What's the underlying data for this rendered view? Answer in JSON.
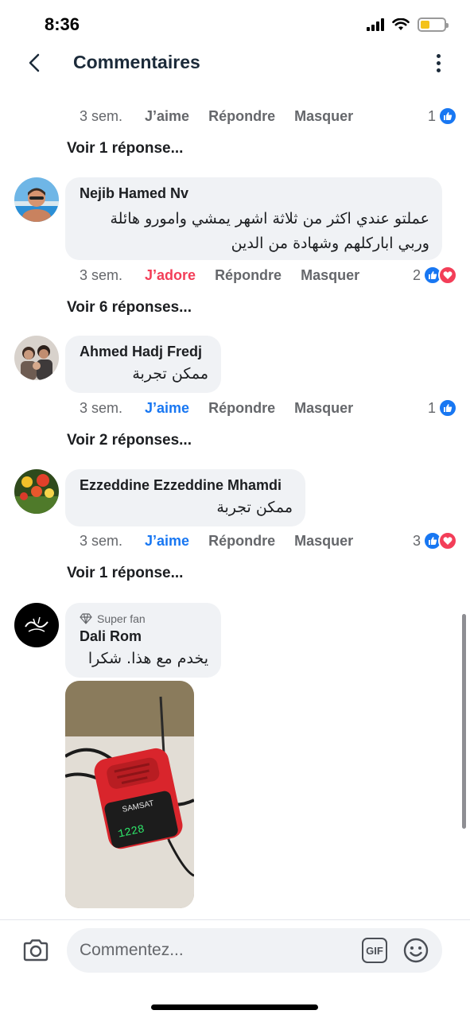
{
  "status_bar": {
    "time": "8:36"
  },
  "header": {
    "title": "Commentaires"
  },
  "colors": {
    "like_blue": "#1877f2",
    "love_red": "#f33e58",
    "bubble_bg": "#f0f2f5",
    "secondary_text": "#65676b"
  },
  "top_actions": {
    "time": "3 sem.",
    "react_label": "J’aime",
    "reply_label": "Répondre",
    "hide_label": "Masquer",
    "reaction_count": "1",
    "see_replies": "Voir 1 réponse..."
  },
  "comments": [
    {
      "author": "Nejib Hamed Nv",
      "text_line1": "عملتو عندي اكثر من ثلاثة اشهر يمشي وامورو هائلة",
      "text_line2": "وربي اباركلهم وشهادة من الدين",
      "time": "3 sem.",
      "react_label": "J’adore",
      "reply_label": "Répondre",
      "hide_label": "Masquer",
      "reaction_count": "2",
      "see_replies": "Voir 6 réponses..."
    },
    {
      "author": "Ahmed Hadj Fredj",
      "text": "ممكن تجربة",
      "time": "3 sem.",
      "react_label": "J’aime",
      "reply_label": "Répondre",
      "hide_label": "Masquer",
      "reaction_count": "1",
      "see_replies": "Voir 2 réponses..."
    },
    {
      "author": "Ezzeddine Ezzeddine Mhamdi",
      "text": "ممكن تجربة",
      "time": "3 sem.",
      "react_label": "J’aime",
      "reply_label": "Répondre",
      "hide_label": "Masquer",
      "reaction_count": "3",
      "see_replies": "Voir 1 réponse..."
    },
    {
      "badge": "Super fan",
      "author": "Dali Rom",
      "text": "يخدم مع هذا. شكرا",
      "device_brand": "SAMSAT",
      "device_display": "1228"
    }
  ],
  "composer": {
    "placeholder": "Commentez...",
    "gif_label": "GIF"
  }
}
